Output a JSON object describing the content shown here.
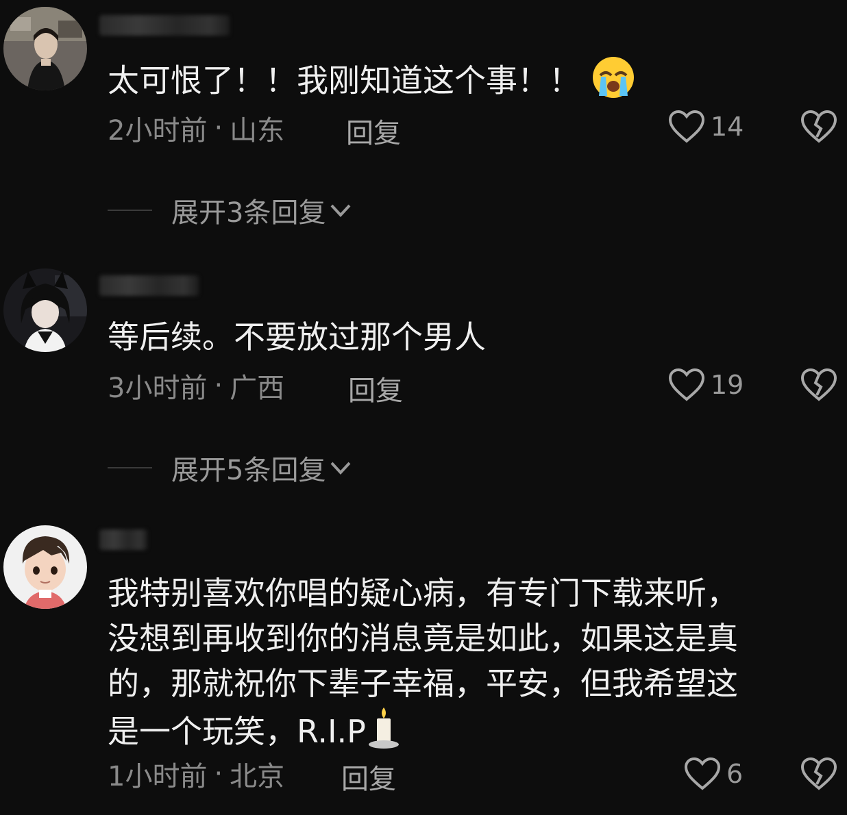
{
  "comments": [
    {
      "text": "太可恨了！！我刚知道这个事！！",
      "emoji": "loudly-crying-face-emoji",
      "time": "2小时前",
      "separator": "·",
      "location": "山东",
      "reply_label": "回复",
      "likes": "14",
      "expand_label": "展开3条回复"
    },
    {
      "text": "等后续。不要放过那个男人",
      "time": "3小时前",
      "separator": "·",
      "location": "广西",
      "reply_label": "回复",
      "likes": "19",
      "expand_label": "展开5条回复"
    },
    {
      "lines": [
        "我特别喜欢你唱的疑心病，有专门下载来听，",
        "没想到再收到你的消息竟是如此，如果这是真",
        "的，那就祝你下辈子幸福，平安，但我希望这",
        "是一个玩笑，R.I.P"
      ],
      "emoji": "candle-emoji",
      "time": "1小时前",
      "separator": "·",
      "location": "北京",
      "reply_label": "回复",
      "likes": "6"
    }
  ],
  "icons": {
    "like": "heart-outline-icon",
    "dislike": "broken-heart-icon",
    "expand": "chevron-down-icon"
  },
  "colors": {
    "background": "#0d0d0d",
    "primary_text": "#efefef",
    "secondary_text": "#8a8a8a"
  }
}
